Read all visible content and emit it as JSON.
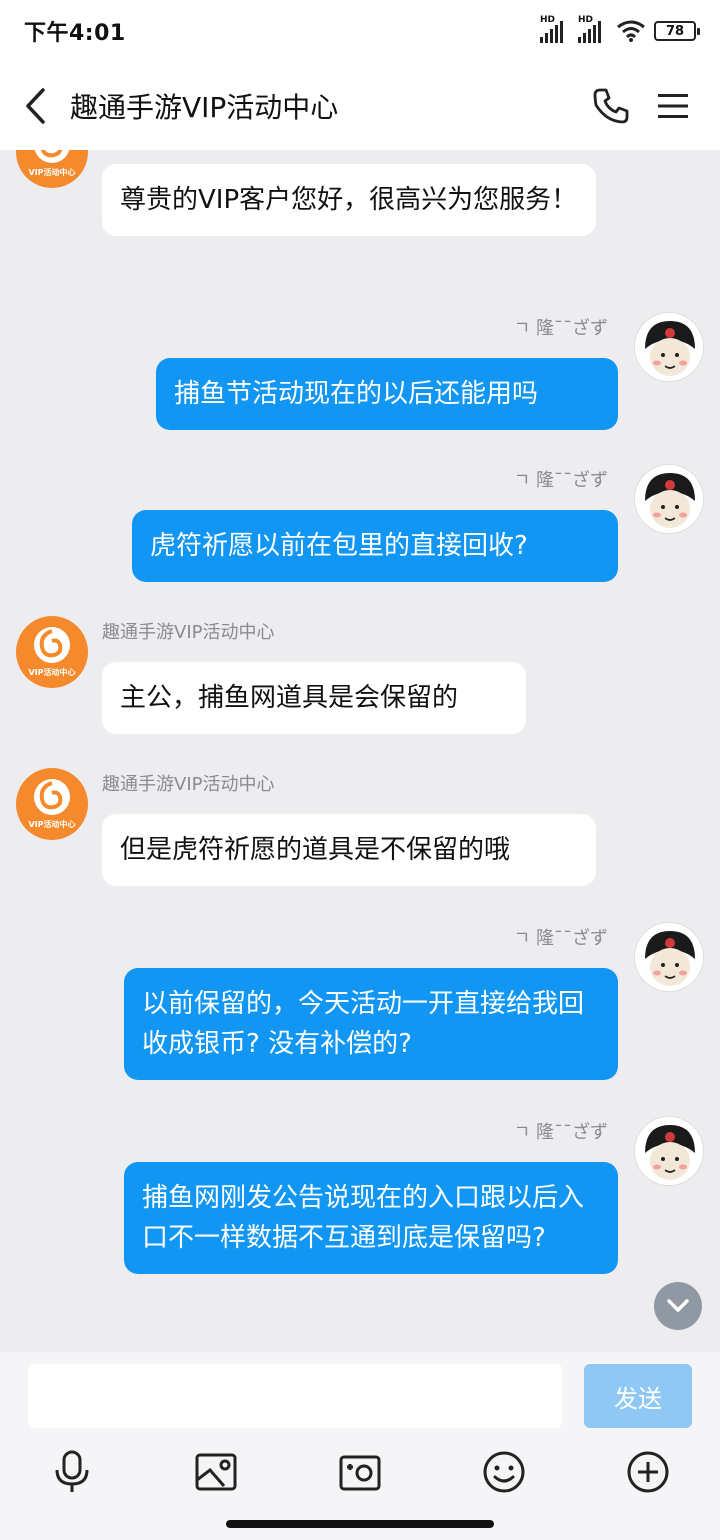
{
  "status_bar": {
    "time": "下午4:01",
    "battery": "78",
    "signal_label": "HD"
  },
  "nav": {
    "title": "趣通手游VIP活动中心"
  },
  "icons": {
    "back": "chevron-left-icon",
    "phone": "phone-icon",
    "menu": "menu-icon"
  },
  "bot_avatar_text": "VIP活动中心",
  "messages": [
    {
      "side": "in",
      "sender": "",
      "text": "尊贵的VIP客户您好，很高兴为您服务！"
    },
    {
      "side": "out",
      "sender": "ㄱ 隆¯¯ざず",
      "text": "捕鱼节活动现在的以后还能用吗"
    },
    {
      "side": "out",
      "sender": "ㄱ 隆¯¯ざず",
      "text": "虎符祈愿以前在包里的直接回收?"
    },
    {
      "side": "in",
      "sender": "趣通手游VIP活动中心",
      "text": "主公，捕鱼网道具是会保留的"
    },
    {
      "side": "in",
      "sender": "趣通手游VIP活动中心",
      "text": "但是虎符祈愿的道具是不保留的哦"
    },
    {
      "side": "out",
      "sender": "ㄱ 隆¯¯ざず",
      "text": "以前保留的，今天活动一开直接给我回收成银币? 没有补偿的?"
    },
    {
      "side": "out",
      "sender": "ㄱ 隆¯¯ざず",
      "text": "捕鱼网刚发公告说现在的入口跟以后入口不一样数据不互通到底是保留吗?"
    }
  ],
  "input": {
    "value": "",
    "placeholder": "",
    "send_label": "发送"
  },
  "toolbar": [
    "microphone-icon",
    "image-icon",
    "camera-icon",
    "emoji-icon",
    "add-icon"
  ],
  "colors": {
    "accent": "#1296f3",
    "send_disabled": "#8fc8f4",
    "bot_avatar": "#f58a2c",
    "background": "#ededf0"
  }
}
